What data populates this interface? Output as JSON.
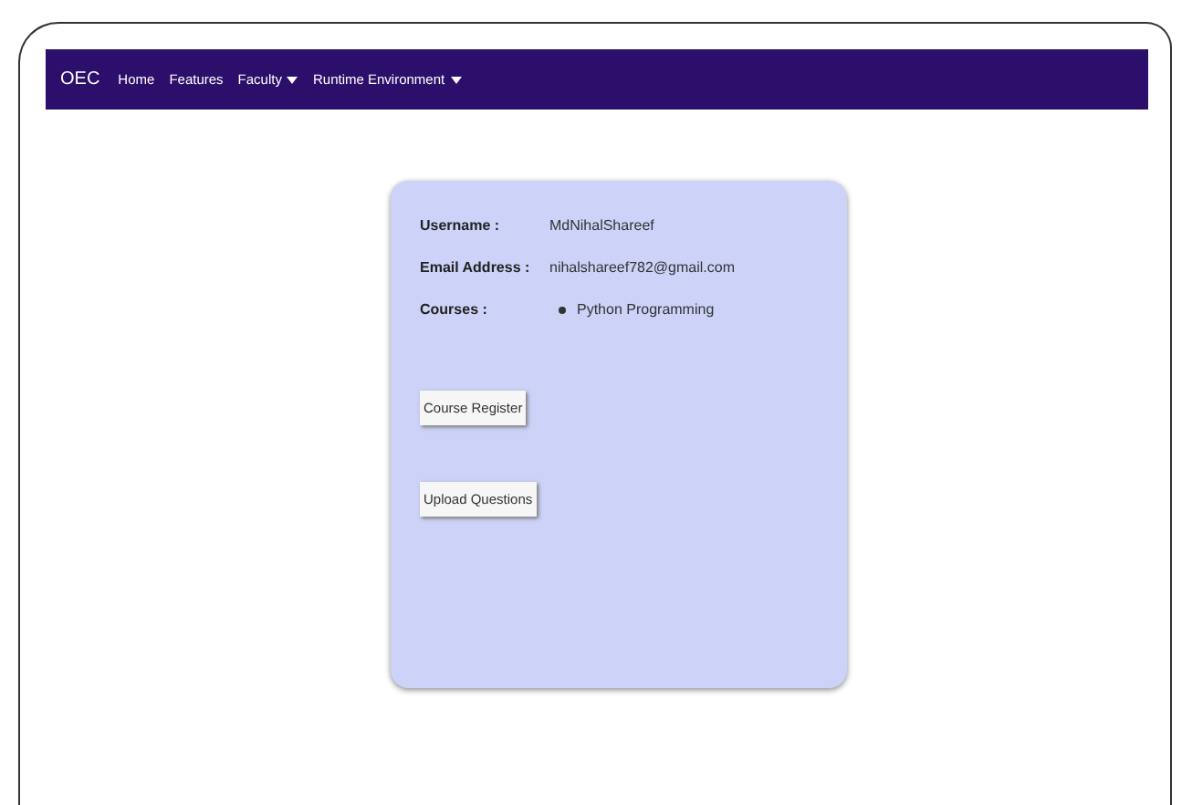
{
  "navbar": {
    "brand": "OEC",
    "items": [
      {
        "label": "Home",
        "dropdown": false
      },
      {
        "label": "Features",
        "dropdown": false
      },
      {
        "label": "Faculty",
        "dropdown": true
      },
      {
        "label": "Runtime Environment",
        "dropdown": true
      }
    ]
  },
  "profile": {
    "fields": [
      {
        "label": "Username :",
        "value": "MdNihalShareef"
      },
      {
        "label": "Email Address :",
        "value": "nihalshareef782@gmail.com"
      }
    ],
    "courses_label": "Courses :",
    "courses": [
      "Python Programming"
    ],
    "buttons": [
      "Course Register",
      "Upload Questions"
    ]
  }
}
